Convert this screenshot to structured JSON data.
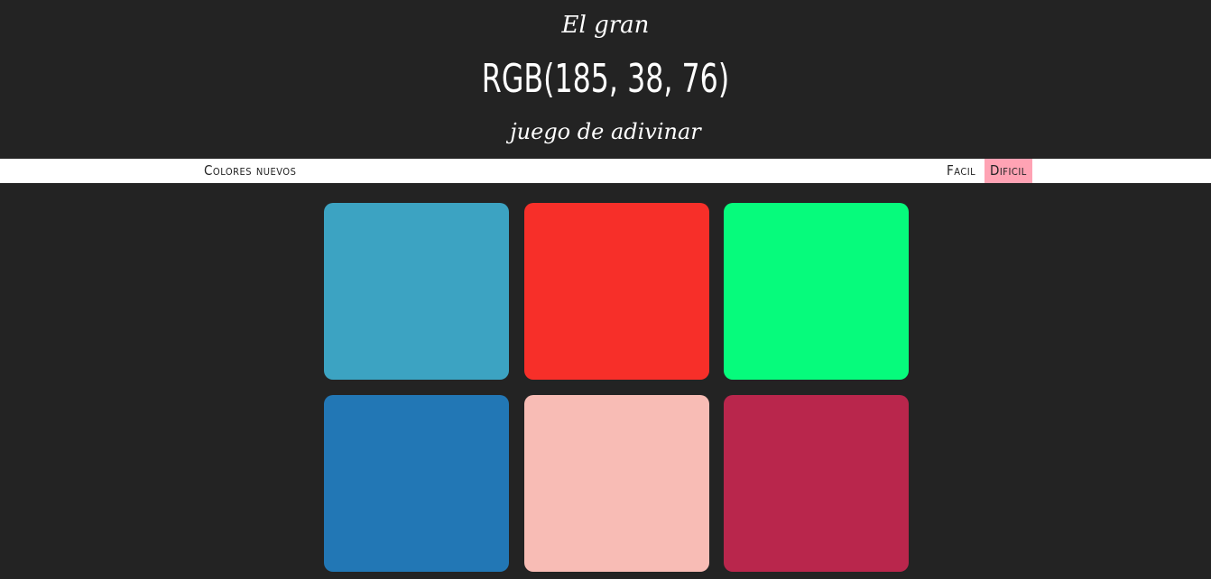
{
  "header": {
    "title_top": "El gran",
    "rgb_display": "RGB(185, 38, 76)",
    "title_bottom": "juego de adivinar"
  },
  "stripe": {
    "new_colors_label": "Colores nuevos",
    "easy_label": "Facil",
    "hard_label": "Dificil",
    "selected_mode": "hard"
  },
  "squares": [
    {
      "color": "#3ca3c2"
    },
    {
      "color": "#f72f29"
    },
    {
      "color": "#06fb7c"
    },
    {
      "color": "#2277b5"
    },
    {
      "color": "#f8bcb5"
    },
    {
      "color": "#b9264c"
    }
  ],
  "colors": {
    "background": "#232323",
    "stripe_background": "#ffffff",
    "selected_mode_background": "#ffa3b4",
    "header_text": "#ffffff"
  }
}
